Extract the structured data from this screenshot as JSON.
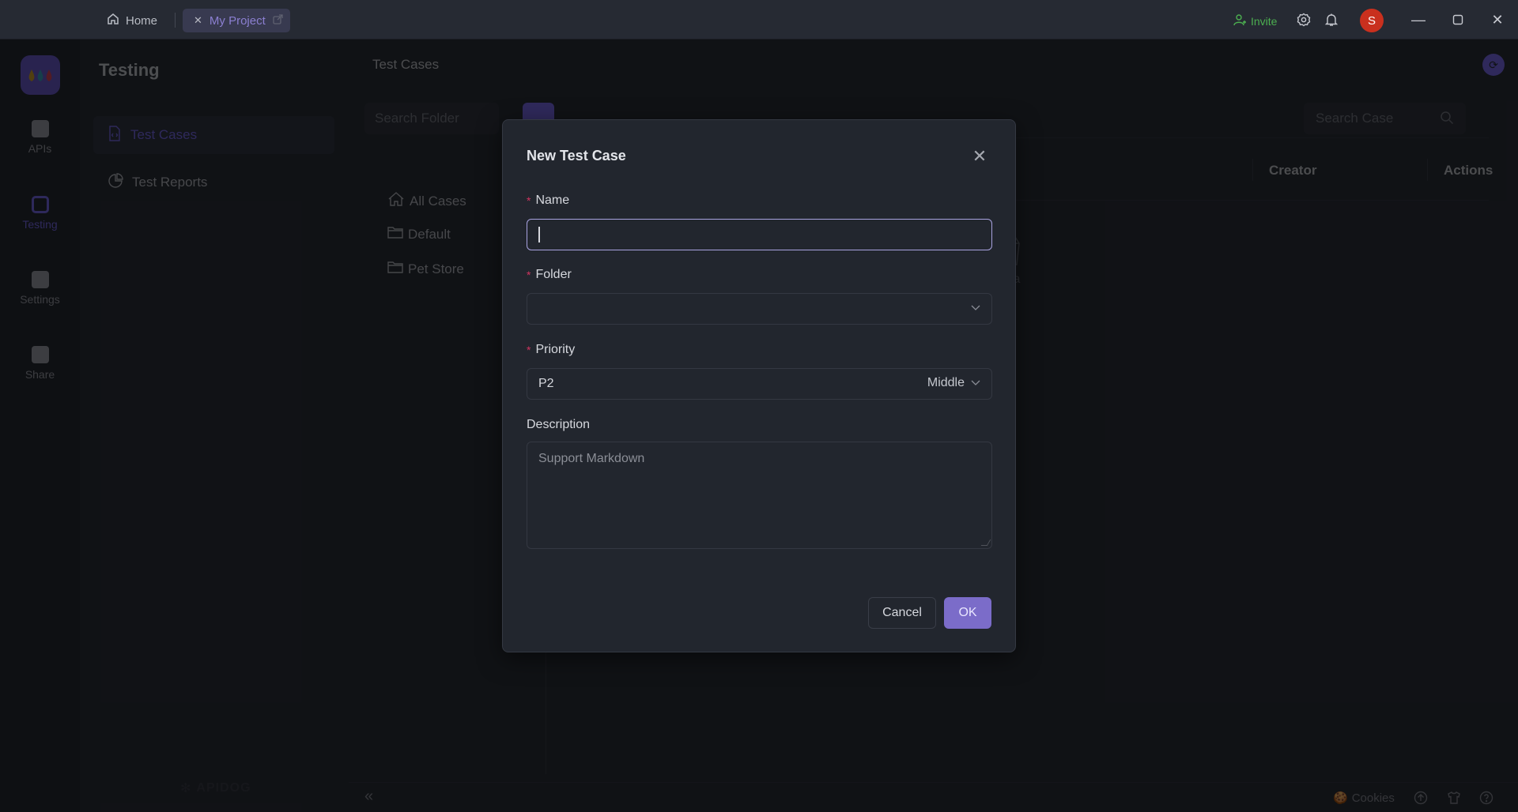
{
  "titlebar": {
    "tabs": [
      {
        "label": "Home",
        "icon": "home-icon"
      },
      {
        "label": "My Project",
        "icon": "close-icon",
        "active": true
      }
    ],
    "invite_label": "Invite",
    "avatar_initial": "S"
  },
  "rail": {
    "items": [
      {
        "label": "APIs",
        "icon": "api-icon"
      },
      {
        "label": "Testing",
        "icon": "testing-icon",
        "active": true
      },
      {
        "label": "Settings",
        "icon": "settings-icon"
      },
      {
        "label": "Share",
        "icon": "share-icon"
      }
    ]
  },
  "subnav": {
    "title": "Testing",
    "items": [
      {
        "label": "Test Cases",
        "icon": "file-code-icon",
        "active": true
      },
      {
        "label": "Test Reports",
        "icon": "pie-chart-icon"
      }
    ],
    "brand": "APIDOG"
  },
  "main": {
    "title": "Test Cases",
    "search_folder_placeholder": "Search Folder",
    "folders": [
      {
        "label": "All Cases",
        "icon": "home-icon"
      },
      {
        "label": "Default",
        "icon": "folder-icon"
      },
      {
        "label": "Pet Store",
        "icon": "folder-icon"
      }
    ],
    "search_case_placeholder": "Search Case",
    "columns": [
      "Creator",
      "Actions"
    ],
    "empty_text": "No Data"
  },
  "bottom": {
    "cookies_label": "Cookies"
  },
  "modal": {
    "title": "New Test Case",
    "fields": {
      "name": {
        "label": "Name",
        "value": "",
        "required": true
      },
      "folder": {
        "label": "Folder",
        "value": "",
        "required": true
      },
      "priority": {
        "label": "Priority",
        "value": "P2",
        "value_desc": "Middle",
        "required": true
      },
      "description": {
        "label": "Description",
        "placeholder": "Support Markdown",
        "required": false
      }
    },
    "cancel_label": "Cancel",
    "ok_label": "OK"
  },
  "colors": {
    "accent": "#7b6cc9",
    "required": "#d0345f",
    "invite": "#4caf50",
    "avatar": "#c9301e"
  }
}
